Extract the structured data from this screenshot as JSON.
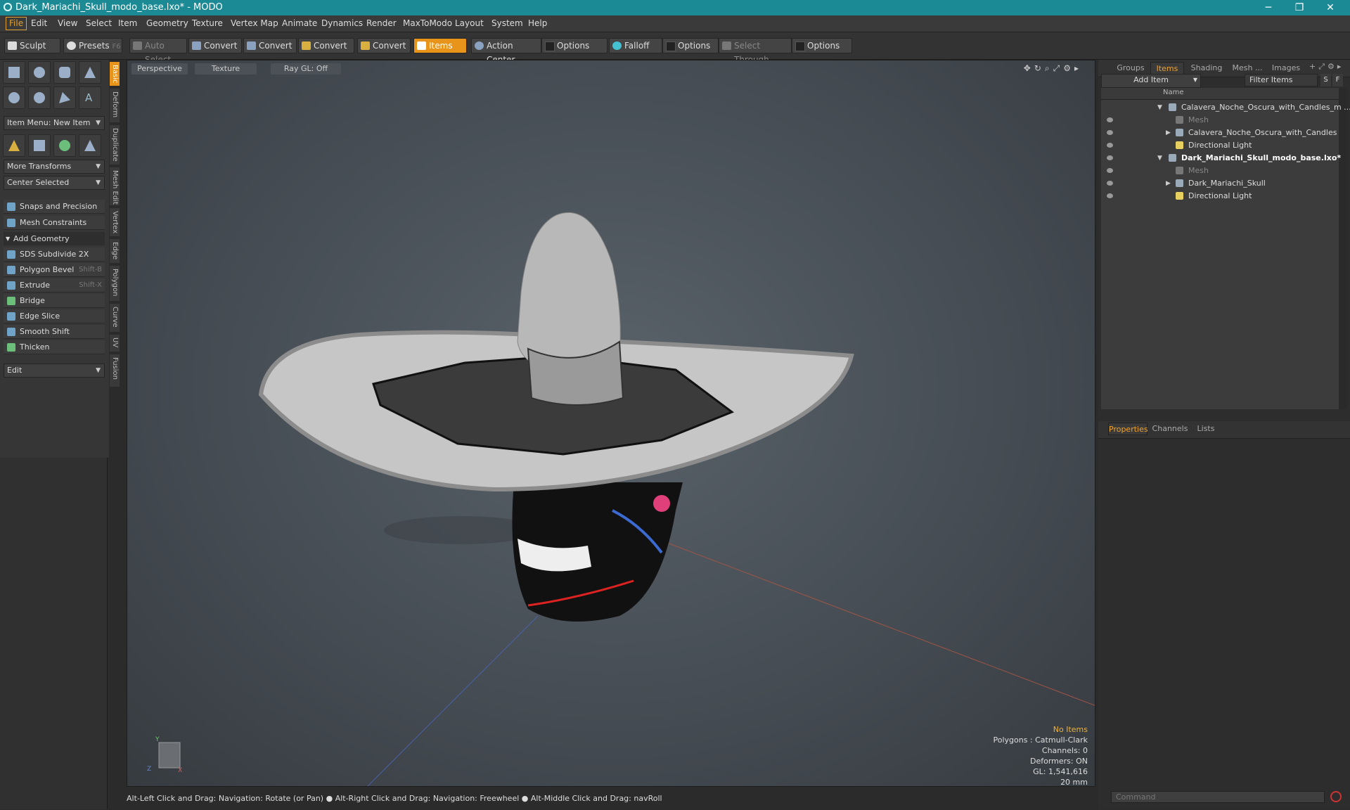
{
  "window": {
    "title": "Dark_Mariachi_Skull_modo_base.lxo* - MODO",
    "minimize": "─",
    "maximize": "❐",
    "close": "✕"
  },
  "menu": [
    "File",
    "Edit",
    "View",
    "Select",
    "Item",
    "Geometry",
    "Texture",
    "Vertex Map",
    "Animate",
    "Dynamics",
    "Render",
    "MaxToModo",
    "Layout",
    "System",
    "Help"
  ],
  "toolbar": {
    "sculpt": "Sculpt",
    "presets": "Presets",
    "presets_key": "F6",
    "auto_select": "Auto Select",
    "convert1": "Convert",
    "convert2": "Convert",
    "convert3": "Convert",
    "convert4": "Convert",
    "items": "Items",
    "action_center": "Action Center",
    "options1": "Options",
    "falloff": "Falloff",
    "options2": "Options",
    "select_through": "Select Through",
    "options3": "Options"
  },
  "left": {
    "item_menu": "Item Menu: New Item",
    "more_transforms": "More Transforms",
    "center_selected": "Center Selected",
    "snaps": "Snaps and Precision",
    "mesh_constraints": "Mesh Constraints",
    "add_geometry": "Add Geometry",
    "tools": [
      {
        "label": "SDS Subdivide 2X",
        "key": ""
      },
      {
        "label": "Polygon Bevel",
        "key": "Shift-B"
      },
      {
        "label": "Extrude",
        "key": "Shift-X"
      },
      {
        "label": "Bridge",
        "key": ""
      },
      {
        "label": "Edge Slice",
        "key": ""
      },
      {
        "label": "Smooth Shift",
        "key": ""
      },
      {
        "label": "Thicken",
        "key": ""
      }
    ],
    "edit": "Edit",
    "vtabs": [
      "Basic",
      "Deform",
      "Duplicate",
      "Mesh Edit",
      "Vertex",
      "Edge",
      "Polygon",
      "Curve",
      "UV",
      "Fusion"
    ]
  },
  "viewport": {
    "perspective": "Perspective",
    "texture": "Texture",
    "raygl": "Ray GL: Off",
    "info": {
      "no_items": "No Items",
      "polygons": "Polygons : Catmull-Clark",
      "channels": "Channels: 0",
      "deformers": "Deformers: ON",
      "gl": "GL: 1,541,616",
      "scale": "20 mm"
    }
  },
  "status": "Alt-Left Click and Drag: Navigation: Rotate (or Pan) ● Alt-Right Click and Drag: Navigation: Freewheel ● Alt-Middle Click and Drag: navRoll",
  "right": {
    "tabs": [
      "Groups",
      "Items",
      "Shading",
      "Mesh ...",
      "Images"
    ],
    "add_item": "Add Item",
    "filter": "Filter Items",
    "s": "S",
    "f": "F",
    "name_col": "Name",
    "tree": [
      "Calavera_Noche_Oscura_with_Candles_m ...",
      "Mesh",
      "Calavera_Noche_Oscura_with_Candles",
      "Directional Light",
      "Dark_Mariachi_Skull_modo_base.lxo*",
      "Mesh",
      "Dark_Mariachi_Skull",
      "Directional Light"
    ],
    "bottom_tabs": [
      "Properties",
      "Channels",
      "Lists"
    ],
    "command_placeholder": "Command"
  },
  "colors": {
    "accent": "#e8941a",
    "titlebar": "#1c8a95"
  }
}
